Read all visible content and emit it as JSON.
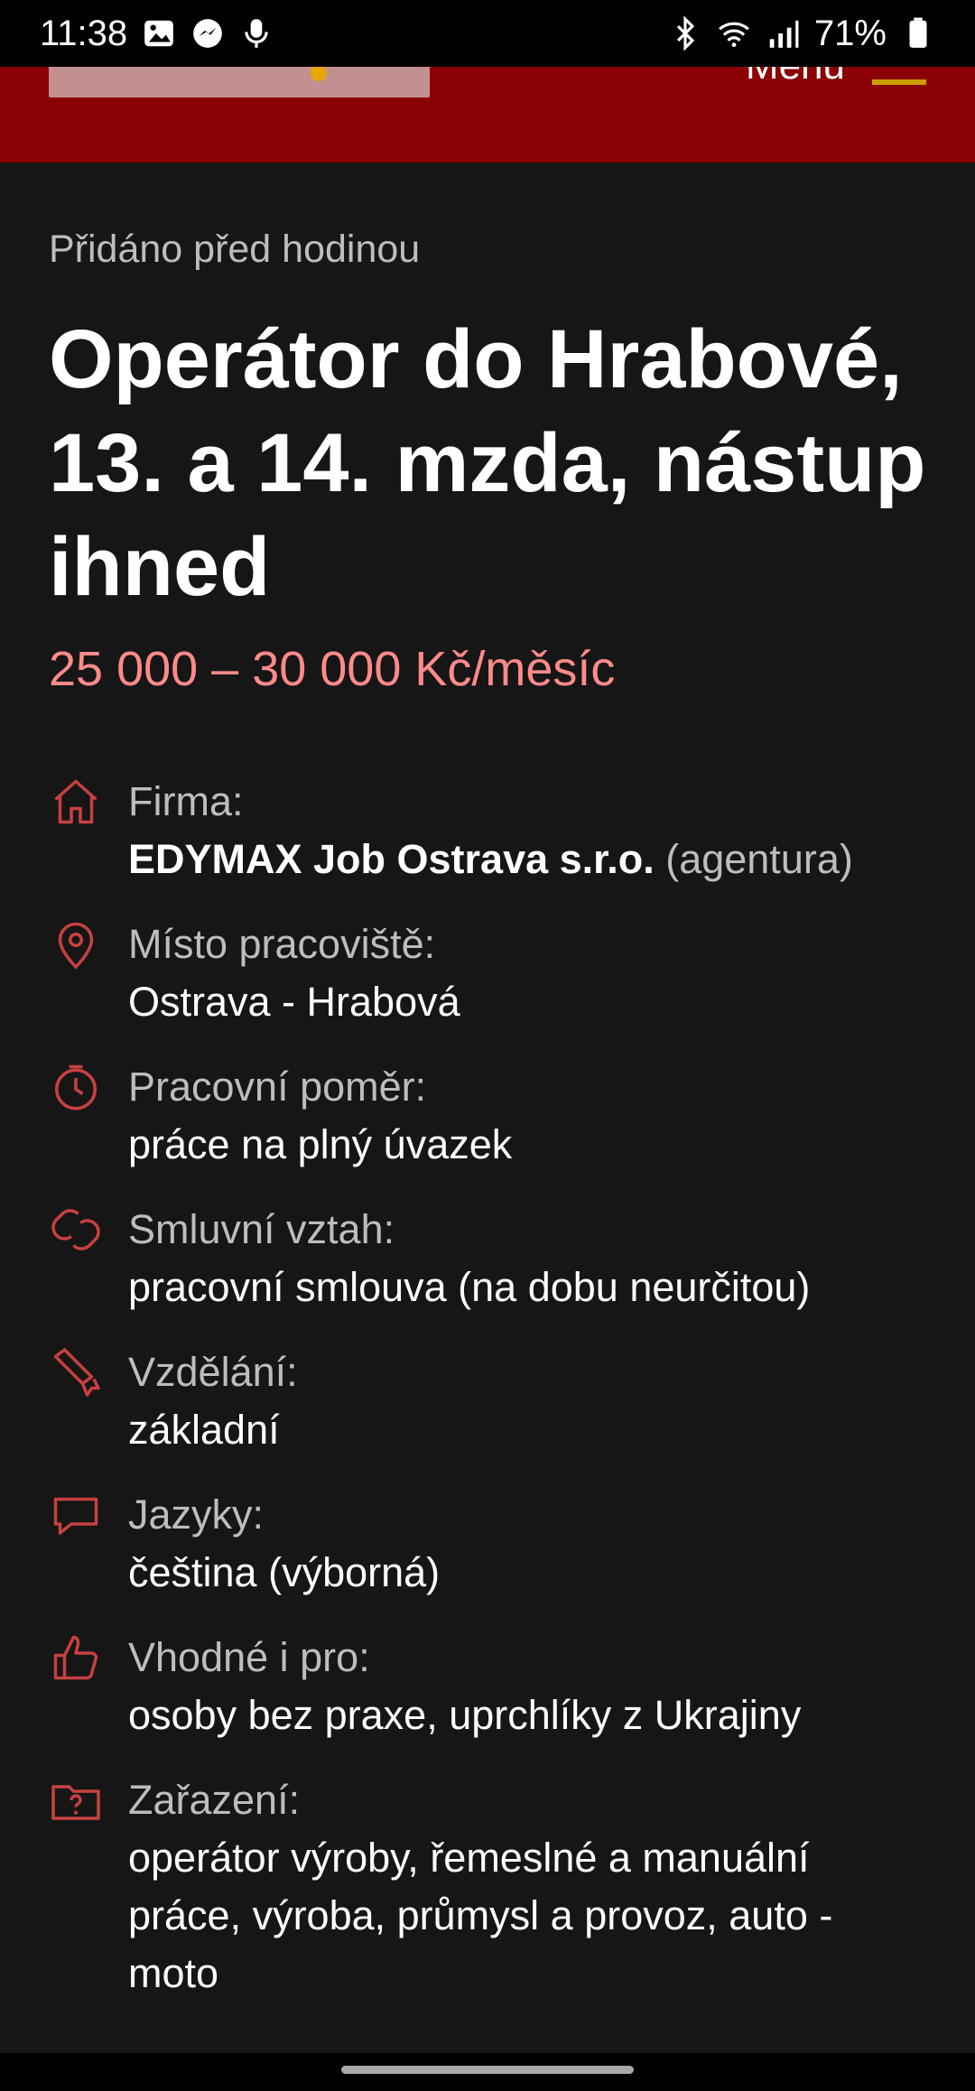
{
  "status_bar": {
    "time": "11:38",
    "battery": "71%"
  },
  "header": {
    "menu_label": "Menu"
  },
  "job": {
    "added": "Přidáno před hodinou",
    "title": "Operátor do Hrabové, 13. a 14. mzda, nástup ihned",
    "salary": "25 000 – 30 000 Kč/měsíc"
  },
  "details": {
    "company": {
      "label": "Firma:",
      "name": "EDYMAX Job Ostrava s.r.o.",
      "note": "(agentura)",
      "icon": "house-icon"
    },
    "location": {
      "label": "Místo pracoviště:",
      "value": "Ostrava - Hrabová",
      "icon": "location-pin-icon"
    },
    "employment": {
      "label": "Pracovní poměr:",
      "value": "práce na plný úvazek",
      "icon": "clock-icon"
    },
    "contract": {
      "label": "Smluvní vztah:",
      "value": "pracovní smlouva (na dobu neurčitou)",
      "icon": "link-icon"
    },
    "education": {
      "label": "Vzdělání:",
      "value": "základní",
      "icon": "diploma-icon"
    },
    "languages": {
      "label": "Jazyky:",
      "value": "čeština (výborná)",
      "icon": "speech-bubble-icon"
    },
    "suitable": {
      "label": "Vhodné i pro:",
      "value": "osoby bez praxe, uprchlíky z Ukrajiny",
      "icon": "thumbs-up-icon"
    },
    "category": {
      "label": "Zařazení:",
      "value": "operátor výroby, řemeslné a manuální práce, výroba, průmysl a provoz, auto - moto",
      "icon": "folder-question-icon"
    }
  },
  "colors": {
    "accent": "#8b0000",
    "salary": "#ff8a8a",
    "icon": "#c84040"
  }
}
